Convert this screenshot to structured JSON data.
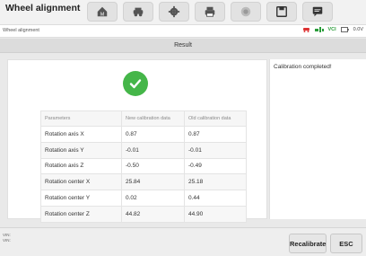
{
  "header": {
    "title": "Wheel alignment",
    "nav_icons": [
      "home-icon",
      "vehicle-icon",
      "gear-icon",
      "printer-icon",
      "camera-icon",
      "save-icon",
      "message-icon"
    ]
  },
  "breadcrumb": {
    "text": "Wheel alignment"
  },
  "status": {
    "vci_label": "VCI",
    "voltage": "0.0V"
  },
  "result": {
    "title": "Result",
    "message": "Calibration completed!"
  },
  "table": {
    "headers": [
      "Parameters",
      "New calibration data",
      "Old calibration data"
    ],
    "rows": [
      [
        "Rotation axis X",
        "0.87",
        "0.87"
      ],
      [
        "Rotation axis Y",
        "-0.01",
        "-0.01"
      ],
      [
        "Rotation axis Z",
        "-0.50",
        "-0.49"
      ],
      [
        "Rotation center X",
        "25.84",
        "25.18"
      ],
      [
        "Rotation center Y",
        "0.02",
        "0.44"
      ],
      [
        "Rotation center Z",
        "44.82",
        "44.90"
      ]
    ]
  },
  "footer": {
    "vin_label": "VIN:",
    "vin2_label": "VIN:",
    "recalibrate_label": "Recalibrate",
    "esc_label": "ESC"
  }
}
